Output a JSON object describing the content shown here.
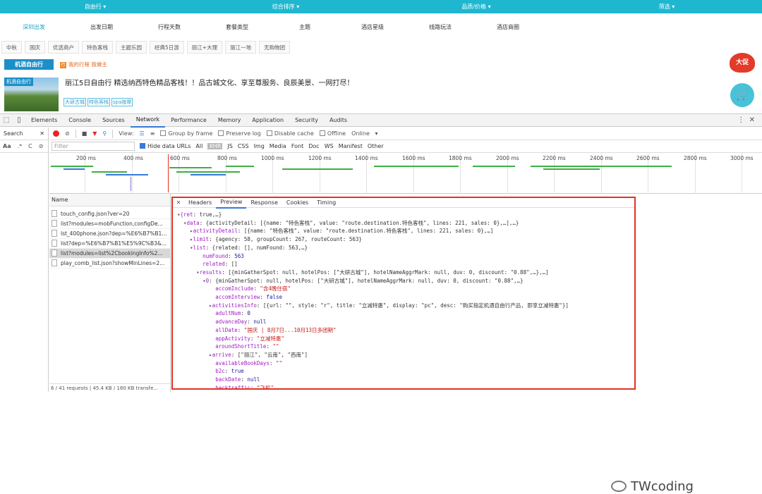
{
  "top_nav": [
    "自由行 ▾",
    "综合排序 ▾",
    "品质/价格 ▾",
    "筛选 ▾"
  ],
  "filters": [
    "深圳出发",
    "出发日期",
    "行程天数",
    "套餐类型",
    "主题",
    "酒店星级",
    "线路玩法",
    "酒店商圈"
  ],
  "tags": [
    "中秋",
    "国庆",
    "优选商户",
    "特色客栈",
    "主题乐园",
    "经典5日游",
    "丽江+大理",
    "丽江一地",
    "无购物团"
  ],
  "promo_label": "机酒自由行",
  "mytrip_text": "我的行程 我做主",
  "product": {
    "thumb_tag": "机酒自由行",
    "title": "丽江5日自由行 精选纳西特色精品客栈！！品古城文化、享至尊服务、良辰美景、一网打尽！",
    "labels": [
      "大研古城",
      "特色客栈",
      "spa按摩"
    ]
  },
  "badge_text": "大促",
  "cart_icon": "cart-icon",
  "devtools": {
    "tabs": [
      "Elements",
      "Console",
      "Sources",
      "Network",
      "Performance",
      "Memory",
      "Application",
      "Security",
      "Audits"
    ],
    "search_label": "Search",
    "toolbar": {
      "view": "View:",
      "group_by_frame": "Group by frame",
      "preserve_log": "Preserve log",
      "disable_cache": "Disable cache",
      "offline": "Offline",
      "online": "Online"
    },
    "filter_placeholder": "Filter",
    "hide_data_urls": "Hide data URLs",
    "types": [
      "All",
      "XHR",
      "JS",
      "CSS",
      "Img",
      "Media",
      "Font",
      "Doc",
      "WS",
      "Manifest",
      "Other"
    ],
    "timeline_ticks": [
      "200 ms",
      "400 ms",
      "600 ms",
      "800 ms",
      "1000 ms",
      "1200 ms",
      "1400 ms",
      "1600 ms",
      "1800 ms",
      "2000 ms",
      "2200 ms",
      "2400 ms",
      "2600 ms",
      "2800 ms",
      "3000 ms"
    ],
    "name_header": "Name",
    "requests": [
      "touch_config.json?ver=20",
      "list?modules=mobFunction,configDe...",
      "lst_400phone.json?dep=%E6%B7%B1...",
      "list?dep=%E6%B7%B1%E5%9C%B3&...",
      "list?modules=list%2CbookingInfo%2...",
      "play_comb_list.json?showMinLines=2..."
    ],
    "footer": "6 / 41 requests | 45.4 KB / 180 KB transfe...",
    "preview_tabs": [
      "Headers",
      "Preview",
      "Response",
      "Cookies",
      "Timing"
    ]
  },
  "preview_lines": [
    "▾{ret: true,…}",
    "  ▾data: {activityDetail: [{name: \"特色客栈\", value: \"route.destination.特色客栈\", lines: 221, sales: 0},…],…}",
    "    ▸activityDetail: [{name: \"特色客栈\", value: \"route.destination.特色客栈\", lines: 221, sales: 0},…]",
    "    ▸limit: {agency: 58, groupCount: 267, routeCount: 563}",
    "    ▾list: {related: [], numFound: 563,…}",
    "        numFound: 563",
    "        related: []",
    "      ▾results: [{minGatherSpot: null, hotelPos: [\"大研古城\"], hotelNameAggrMark: null, duv: 0, discount: \"0.88\",…},…]",
    "        ▾0: {minGatherSpot: null, hotelPos: [\"大研古城\"], hotelNameAggrMark: null, duv: 0, discount: \"0.88\",…}",
    "            accomInclude: \"含4晚住宿\"",
    "            accomInterview: false",
    "          ▸activitiesInfo: [{url: \"\", style: \"r\", title: \"立减特惠\", display: \"pc\", desc: \"购买指定机酒自由行产品, 即享立减特惠\"}]",
    "            adultNum: 0",
    "            advanceDay: null",
    "            allDate: \"国庆 | 8月7日...10月13日多团期\"",
    "            appActivity: \"立减特惠\"",
    "            aroundShortTitle: \"\"",
    "          ▸arrive: [\"丽江\", \"云南\", \"西南\"]",
    "            availableBookDays: \"\"",
    "            b2c: true",
    "            backDate: null",
    "            backtraffic: \"飞机\"",
    "            "
  ],
  "watermark": "TWcoding"
}
